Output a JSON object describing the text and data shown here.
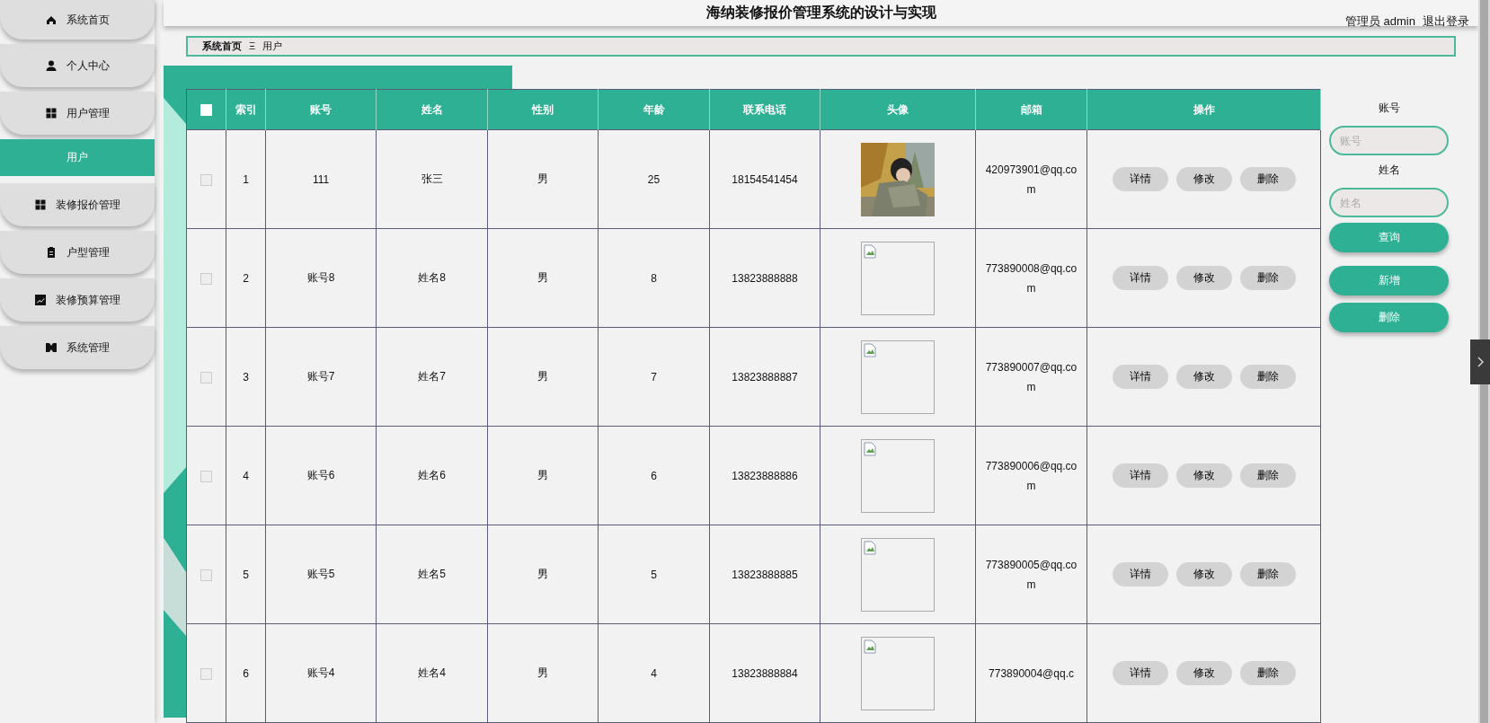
{
  "sidebar": {
    "items": [
      {
        "label": "系统首页",
        "selected": false
      },
      {
        "label": "个人中心",
        "selected": false
      },
      {
        "label": "用户管理",
        "selected": false,
        "children": [
          {
            "label": "用户",
            "selected": true
          }
        ]
      },
      {
        "label": "装修报价管理",
        "selected": false
      },
      {
        "label": "户型管理",
        "selected": false
      },
      {
        "label": "装修预算管理",
        "selected": false
      },
      {
        "label": "系统管理",
        "selected": false
      }
    ]
  },
  "header": {
    "title": "海纳装修报价管理系统的设计与实现",
    "user": "管理员 admin",
    "logout": "退出登录"
  },
  "breadcrumb": {
    "items": [
      "系统首页",
      "用户"
    ],
    "separator": "Ξ"
  },
  "table": {
    "select_all_checked": false,
    "columns": [
      "索引",
      "账号",
      "姓名",
      "性别",
      "年龄",
      "联系电话",
      "头像",
      "邮箱",
      "操作"
    ],
    "rows": [
      {
        "checked": false,
        "cells": [
          "1",
          "111",
          "张三",
          "男",
          "25",
          "18154541454"
        ],
        "avatar": {
          "kind": "picture"
        },
        "email": "420973901@qq.com",
        "actions": [
          "详情",
          "修改",
          "删除"
        ]
      },
      {
        "checked": false,
        "cells": [
          "2",
          "账号8",
          "姓名8",
          "男",
          "8",
          "13823888888"
        ],
        "avatar": {
          "kind": "broken"
        },
        "email": "773890008@qq.com",
        "actions": [
          "详情",
          "修改",
          "删除"
        ]
      },
      {
        "checked": false,
        "cells": [
          "3",
          "账号7",
          "姓名7",
          "男",
          "7",
          "13823888887"
        ],
        "avatar": {
          "kind": "broken"
        },
        "email": "773890007@qq.com",
        "actions": [
          "详情",
          "修改",
          "删除"
        ]
      },
      {
        "checked": false,
        "cells": [
          "4",
          "账号6",
          "姓名6",
          "男",
          "6",
          "13823888886"
        ],
        "avatar": {
          "kind": "broken"
        },
        "email": "773890006@qq.com",
        "actions": [
          "详情",
          "修改",
          "删除"
        ]
      },
      {
        "checked": false,
        "cells": [
          "5",
          "账号5",
          "姓名5",
          "男",
          "5",
          "13823888885"
        ],
        "avatar": {
          "kind": "broken"
        },
        "email": "773890005@qq.com",
        "actions": [
          "详情",
          "修改",
          "删除"
        ]
      },
      {
        "checked": false,
        "cells": [
          "6",
          "账号4",
          "姓名4",
          "男",
          "4",
          "13823888884"
        ],
        "avatar": {
          "kind": "broken"
        },
        "email": "773890004@qq.c",
        "actions": [
          "详情",
          "修改",
          "删除"
        ]
      }
    ]
  },
  "search": {
    "fields": [
      {
        "label": "账号",
        "placeholder": "账号"
      },
      {
        "label": "姓名",
        "placeholder": "姓名"
      }
    ],
    "buttons": [
      "查询",
      "新增",
      "删除"
    ]
  }
}
